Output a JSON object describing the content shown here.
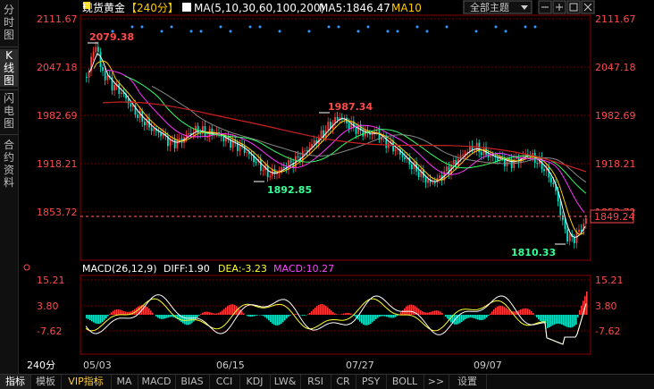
{
  "left_rail": {
    "items": [
      {
        "chars": [
          "分",
          "时",
          "图"
        ]
      },
      {
        "chars": [
          "K",
          "线",
          "图"
        ]
      },
      {
        "chars": [
          "闪",
          "电",
          "图"
        ]
      },
      {
        "chars": [
          "合",
          "约",
          "资",
          "料"
        ]
      }
    ]
  },
  "header": {
    "instrument": "现货黄金",
    "period_bracket": "【240分】",
    "ma_label": "MA(5,10,30,60,100,200)",
    "ma5_label": "MA5:1846.47",
    "ma10_label": "MA10",
    "theme_select": "全部主题",
    "colors": {
      "instrument": "#ffffff",
      "period": "#ffcc00",
      "ma": "#ffffff",
      "ma5": "#ffffff",
      "ma10": "#ffcc00"
    }
  },
  "price_axis": {
    "labels": [
      "2111.67",
      "2047.18",
      "1982.69",
      "1918.21",
      "1853.72"
    ],
    "current_price": "1849.24"
  },
  "annotations": {
    "high": "2079.38",
    "mid_high": "1987.34",
    "low1": "1892.85",
    "low2": "1810.33"
  },
  "macd": {
    "title": "MACD(26,12,9)",
    "diff": "DIFF:1.90",
    "dea": "DEA:-3.23",
    "macd": "MACD:10.27",
    "axis_labels": [
      "15.21",
      "3.80",
      "-7.62"
    ]
  },
  "time_axis": {
    "period": "240分",
    "dates": [
      "05/03",
      "06/15",
      "07/27",
      "09/07"
    ]
  },
  "bottom_tabs": [
    "指标",
    "模板",
    "VIP指标",
    "MA",
    "MACD",
    "BIAS",
    "CCI",
    "KDJ",
    "LW&",
    "RSI",
    "CR",
    "PSY",
    "BOLL",
    ">>",
    "设置"
  ],
  "colors": {
    "up": "#ff3b3b",
    "down": "#00e3c8",
    "ma5": "#ffffff",
    "ma10": "#ffcc00",
    "ma30": "#ff33ff",
    "ma60": "#33ff66",
    "ma100": "#888888",
    "ma200": "#cc2020",
    "grid": "#8b0000",
    "dea": "#ffff33",
    "diff": "#ffffff",
    "macd_label": "#ff44ff"
  }
}
